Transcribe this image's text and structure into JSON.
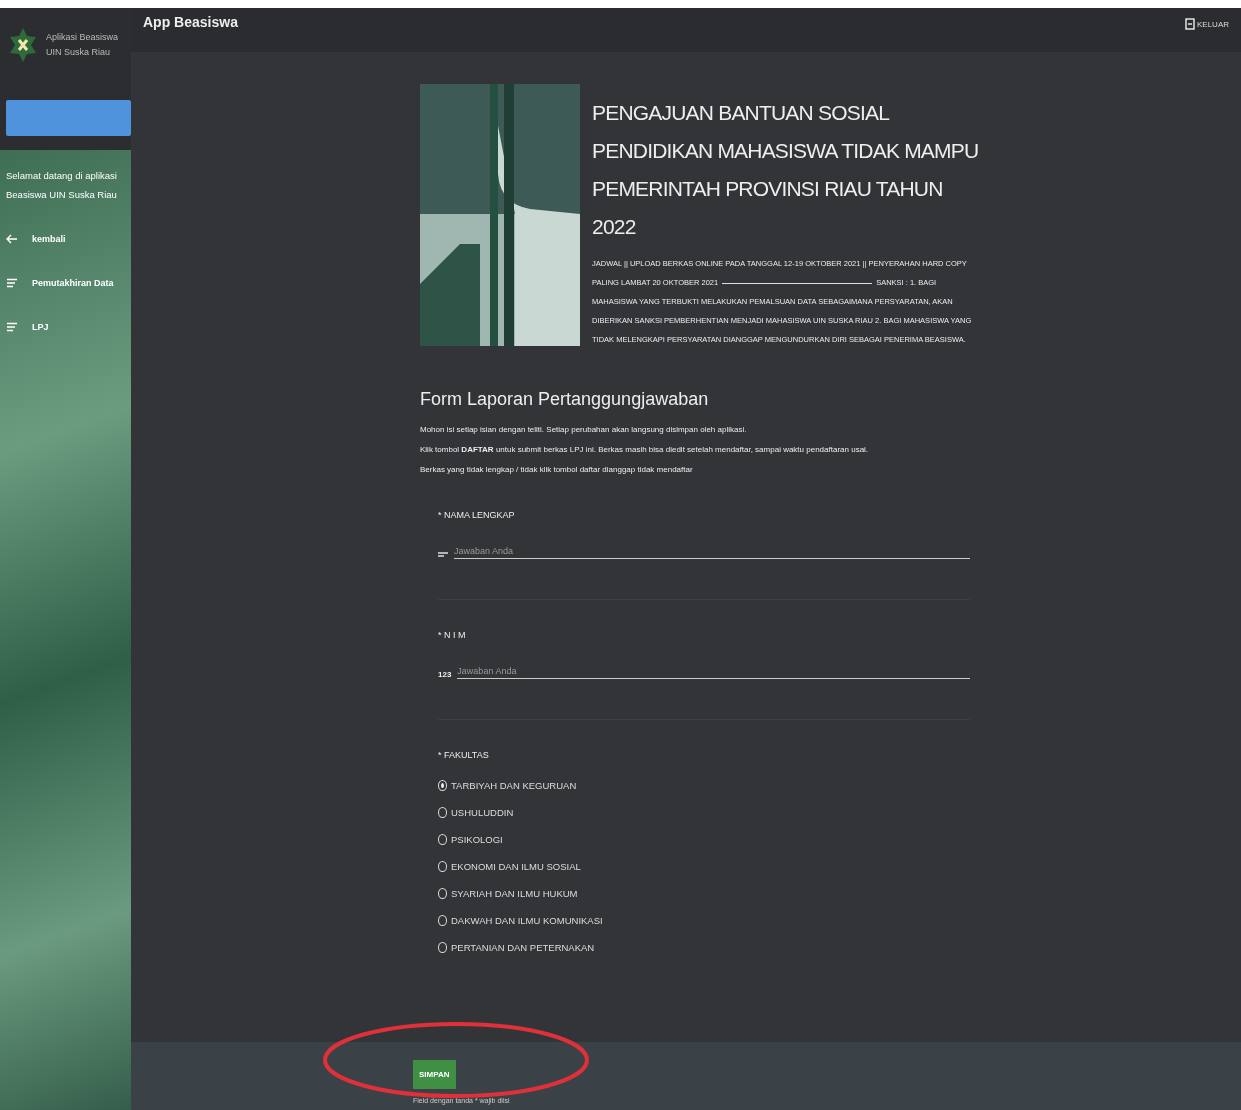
{
  "app_bar": {
    "title": "App Beasiswa",
    "logout": "KELUAR"
  },
  "sidebar": {
    "brand": [
      "Aplikasi Beasiswa",
      "UIN Suska Riau"
    ],
    "welcome": "Selamat datang di aplikasi Beasiswa UIN Suska Riau",
    "items": [
      {
        "kind": "back",
        "label": "kembali"
      },
      {
        "kind": "list",
        "label": "Pemutakhiran Data"
      },
      {
        "kind": "list",
        "label": "LPJ"
      }
    ]
  },
  "header": {
    "title": "PENGAJUAN BANTUAN SOSIAL PENDIDIKAN MAHASISWA TIDAK MAMPU PEMERINTAH PROVINSI RIAU TAHUN 2022",
    "description": [
      "JADWAL || UPLOAD BERKAS ONLINE PADA TANGGAL 12-19 OKTOBER 2021 || PENYERAHAN HARD COPY PALING LAMBAT 20 OKTOBER 2021",
      "SANKSI : 1. BAGI MAHASISWA YANG TERBUKTI MELAKUKAN PEMALSUAN DATA SEBAGAIMANA PERSYARATAN, AKAN DIBERIKAN SANKSI PEMBERHENTIAN MENJADI MAHASISWA UIN SUSKA RIAU 2. BAGI MAHASISWA YANG TIDAK MELENGKAPI PERSYARATAN DIANGGAP MENGUNDURKAN DIRI SEBAGAI PENERIMA BEASISWA."
    ]
  },
  "form": {
    "title": "Form Laporan Pertanggungjawaban",
    "notes": [
      "Mohon isi setiap isian dengan teliti. Setiap perubahan akan langsung disimpan oleh aplikasi.",
      "Klik tombol **DAFTAR** untuk submit berkas LPJ ini. Berkas masih bisa diedit setelah mendaftar, sampai waktu pendaftaran usai.",
      "Berkas yang tidak lengkap / tidak klik tombol daftar dianggap tidak mendaftar"
    ],
    "fields": [
      {
        "kind": "text",
        "label": "* NAMA LENGKAP",
        "placeholder": "Jawaban Anda"
      },
      {
        "kind": "number",
        "label": "* N I M",
        "placeholder": "Jawaban Anda",
        "icon": "123"
      },
      {
        "kind": "radio",
        "label": "* FAKULTAS",
        "options": [
          {
            "label": "TARBIYAH DAN KEGURUAN",
            "selected": true
          },
          {
            "label": "USHULUDDIN",
            "selected": false
          },
          {
            "label": "PSIKOLOGI",
            "selected": false
          },
          {
            "label": "EKONOMI DAN ILMU SOSIAL",
            "selected": false
          },
          {
            "label": "SYARIAH DAN ILMU HUKUM",
            "selected": false
          },
          {
            "label": "DAKWAH DAN ILMU KOMUNIKASI",
            "selected": false
          },
          {
            "label": "PERTANIAN DAN PETERNAKAN",
            "selected": false
          }
        ]
      }
    ]
  },
  "footer": {
    "button": "SIMPAN",
    "note": "Field dengan tanda * wajib diisi"
  }
}
